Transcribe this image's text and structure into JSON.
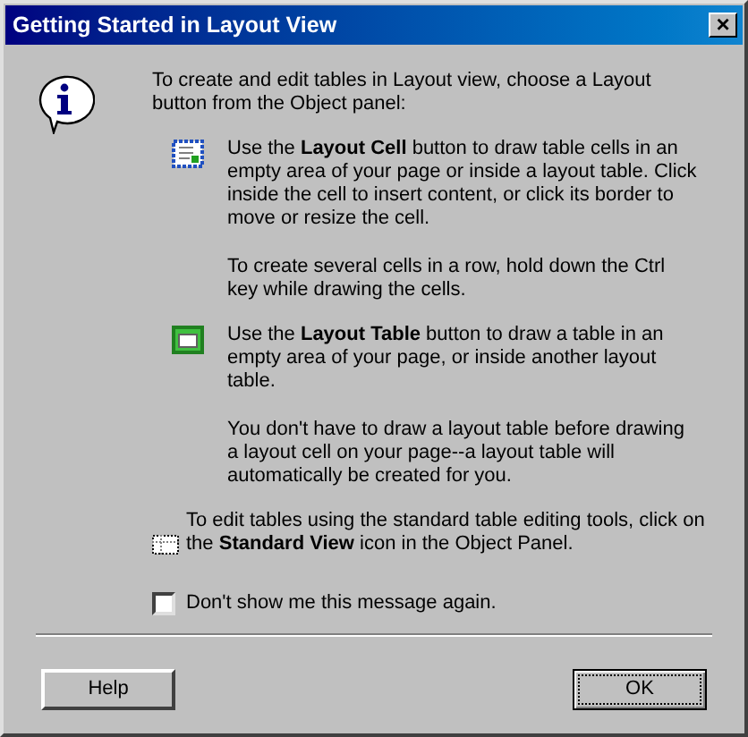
{
  "window": {
    "title": "Getting Started in Layout View",
    "close": "×"
  },
  "intro": "To create and edit tables in Layout view, choose a Layout button from the Object panel:",
  "items": [
    {
      "kind": "cell",
      "text": "Use the **Layout Cell** button to draw table cells in an empty area of your page or inside a layout table. Click inside the cell to insert content, or click its border to move or resize the cell.",
      "note": "To create several cells in a row, hold down the Ctrl key while drawing the cells."
    },
    {
      "kind": "table",
      "text": "Use the **Layout Table** button to draw a table in an empty area of your page, or inside another layout table.",
      "note": "You don't have to draw a layout table before drawing a layout cell on your page--a layout table will automatically be created for you."
    }
  ],
  "standard": "To edit tables using the standard table editing tools, click on the **Standard View** icon in the Object Panel.",
  "checkbox": {
    "label": "Don't show me this message again.",
    "checked": false
  },
  "buttons": [
    {
      "label": "Help",
      "default": false
    },
    {
      "label": "OK",
      "default": true
    }
  ]
}
